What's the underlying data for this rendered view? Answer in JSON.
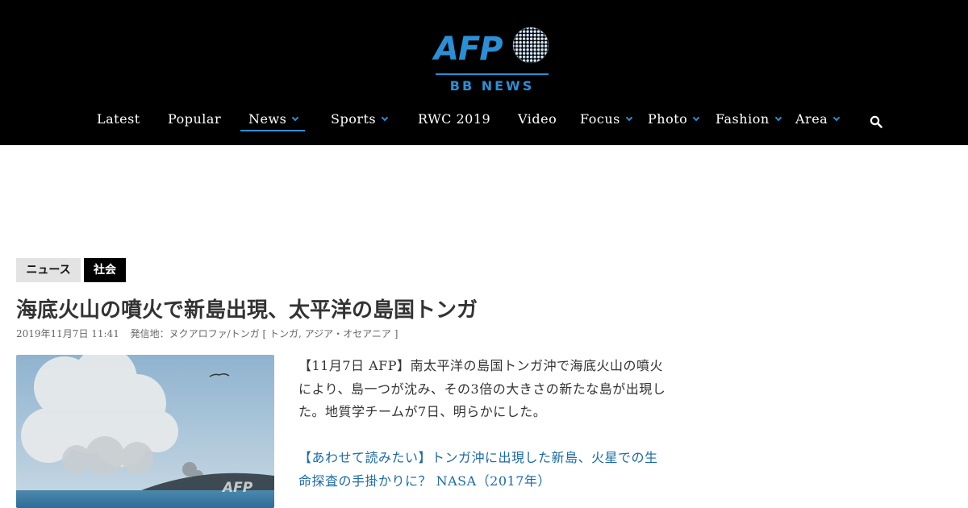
{
  "brand": {
    "logo_main": "AFP",
    "logo_sub": "BB NEWS",
    "accent_color": "#2b8fd6"
  },
  "nav": {
    "items": [
      {
        "label": "Latest",
        "dropdown": false
      },
      {
        "label": "Popular",
        "dropdown": false
      },
      {
        "label": "News",
        "dropdown": true,
        "active": true
      },
      {
        "label": "Sports",
        "dropdown": true
      },
      {
        "label": "RWC 2019",
        "dropdown": false
      },
      {
        "label": "Video",
        "dropdown": false
      },
      {
        "label": "Focus",
        "dropdown": true
      },
      {
        "label": "Photo",
        "dropdown": true
      },
      {
        "label": "Fashion",
        "dropdown": true
      },
      {
        "label": "Area",
        "dropdown": true
      }
    ],
    "search_icon": "search-icon"
  },
  "article": {
    "tags": [
      "ニュース",
      "社会"
    ],
    "title": "海底火山の噴火で新島出現、太平洋の島国トンガ",
    "date": "2019年11月7日 11:41",
    "location": "発信地：ヌクアロファ/トンガ [ トンガ, アジア・オセアニア ]",
    "body": "【11月7日 AFP】南太平洋の島国トンガ沖で海底火山の噴火により、島一つが沈み、その3倍の大きさの新たな島が出現した。地質学チームが7日、明らかにした。",
    "related_link": "【あわせて読みたい】トンガ沖に出現した新島、火星での生命探査の手掛かりに？ NASA（2017年）",
    "photo_watermark": "AFP"
  }
}
